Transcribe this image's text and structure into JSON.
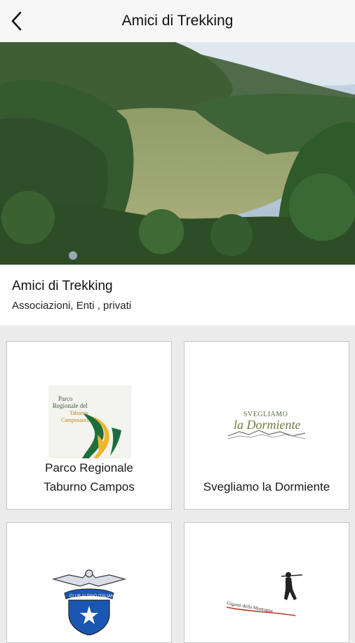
{
  "header": {
    "title": "Amici di Trekking",
    "back_icon": "chevron-left-icon"
  },
  "hero": {
    "alt": "mountain-meadow-photo"
  },
  "entity": {
    "name": "Amici di Trekking",
    "category": "Associazioni, Enti , privati"
  },
  "cards": [
    {
      "label_line1": "Parco Regionale",
      "label_line2": "Taburno Campos",
      "logo_text": [
        "Parco",
        "Regionale del",
        "Taburno",
        "Camposauro"
      ]
    },
    {
      "label": "Svegliamo la Dormiente",
      "logo_text": [
        "SVEGLIAMO",
        "la Dormiente"
      ]
    },
    {
      "logo_text": "CLUB ALPINO ITALIANO"
    },
    {
      "logo_text": "Giganti della Montagna"
    }
  ],
  "colors": {
    "topbar": "#f7f7f7",
    "background": "#ebebeb",
    "card_border": "#c8c8c8"
  }
}
